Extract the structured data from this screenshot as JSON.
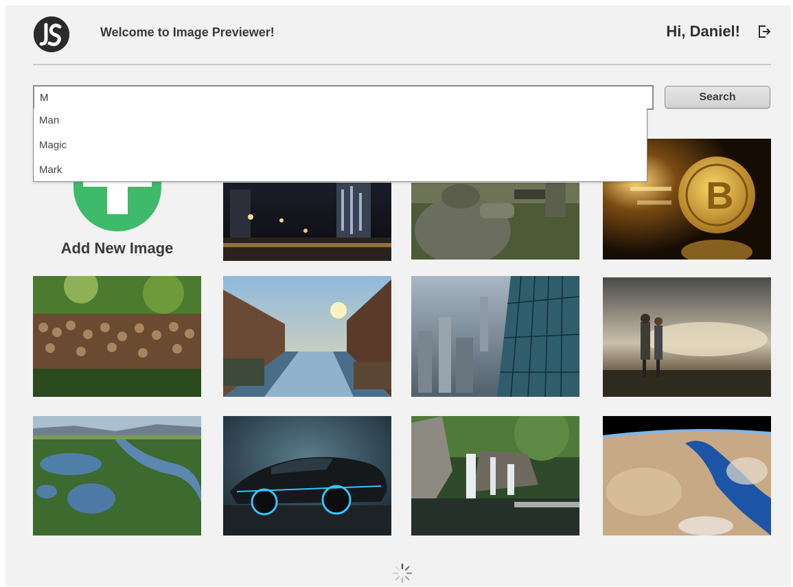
{
  "header": {
    "welcome_text": "Welcome to Image Previewer!",
    "greeting": "Hi, Daniel!",
    "logo_icon": "js-logo-icon",
    "logout_icon": "logout-icon"
  },
  "search": {
    "value": "M",
    "button_label": "Search",
    "suggestions": [
      "Man",
      "Magic",
      "Mark"
    ]
  },
  "add_tile": {
    "label": "Add New Image",
    "icon": "plus-icon",
    "accent_color": "#3dba6a"
  },
  "images": [
    {
      "subject": "city-night"
    },
    {
      "subject": "soldier"
    },
    {
      "subject": "bitcoin"
    },
    {
      "subject": "woodpile"
    },
    {
      "subject": "canal"
    },
    {
      "subject": "skyscraper-aerial"
    },
    {
      "subject": "couple-sunset"
    },
    {
      "subject": "river-aerial"
    },
    {
      "subject": "sports-car"
    },
    {
      "subject": "waterfall"
    },
    {
      "subject": "earth-from-space"
    }
  ],
  "loading_icon": "spinner-icon"
}
